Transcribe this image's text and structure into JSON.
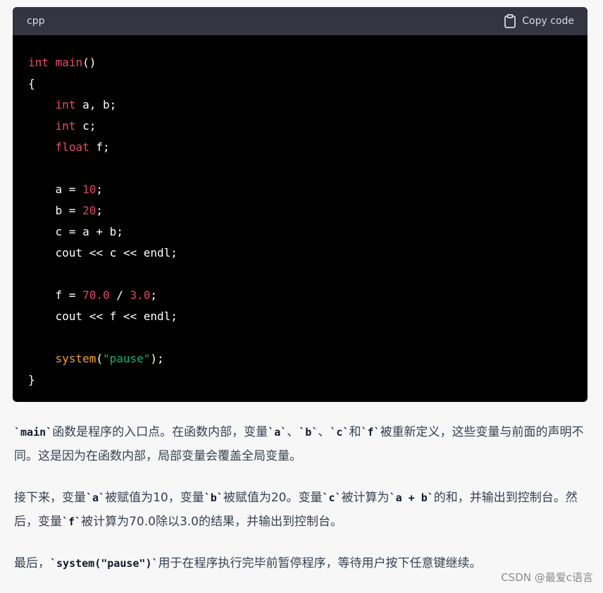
{
  "code_block": {
    "language": "cpp",
    "copy_label": "Copy code",
    "lines": [
      [
        {
          "t": "int",
          "c": "kw"
        },
        {
          "t": " "
        },
        {
          "t": "main",
          "c": "fn"
        },
        {
          "t": "()"
        }
      ],
      [
        {
          "t": "{"
        }
      ],
      [
        {
          "t": "    "
        },
        {
          "t": "int",
          "c": "kw"
        },
        {
          "t": " a, b;"
        }
      ],
      [
        {
          "t": "    "
        },
        {
          "t": "int",
          "c": "kw"
        },
        {
          "t": " c;"
        }
      ],
      [
        {
          "t": "    "
        },
        {
          "t": "float",
          "c": "kw"
        },
        {
          "t": " f;"
        }
      ],
      [
        {
          "t": ""
        }
      ],
      [
        {
          "t": "    a = "
        },
        {
          "t": "10",
          "c": "num"
        },
        {
          "t": ";"
        }
      ],
      [
        {
          "t": "    b = "
        },
        {
          "t": "20",
          "c": "num"
        },
        {
          "t": ";"
        }
      ],
      [
        {
          "t": "    c = a + b;"
        }
      ],
      [
        {
          "t": "    cout << c << endl;"
        }
      ],
      [
        {
          "t": ""
        }
      ],
      [
        {
          "t": "    f = "
        },
        {
          "t": "70.0",
          "c": "num"
        },
        {
          "t": " / "
        },
        {
          "t": "3.0",
          "c": "num"
        },
        {
          "t": ";"
        }
      ],
      [
        {
          "t": "    cout << f << endl;"
        }
      ],
      [
        {
          "t": ""
        }
      ],
      [
        {
          "t": "    "
        },
        {
          "t": "system",
          "c": "sys"
        },
        {
          "t": "("
        },
        {
          "t": "\"pause\"",
          "c": "str"
        },
        {
          "t": ");"
        }
      ],
      [
        {
          "t": "}"
        }
      ]
    ]
  },
  "answer": {
    "paragraphs": [
      [
        {
          "t": "`main`",
          "code": true
        },
        {
          "t": "函数是程序的入口点。在函数内部，变量"
        },
        {
          "t": "`a`",
          "code": true
        },
        {
          "t": "、"
        },
        {
          "t": "`b`",
          "code": true
        },
        {
          "t": "、"
        },
        {
          "t": "`c`",
          "code": true
        },
        {
          "t": "和"
        },
        {
          "t": "`f`",
          "code": true
        },
        {
          "t": "被重新定义，这些变量与前面的声明不同。这是因为在函数内部，局部变量会覆盖全局变量。"
        }
      ],
      [
        {
          "t": "接下来，变量"
        },
        {
          "t": "`a`",
          "code": true
        },
        {
          "t": "被赋值为10，变量"
        },
        {
          "t": "`b`",
          "code": true
        },
        {
          "t": "被赋值为20。变量"
        },
        {
          "t": "`c`",
          "code": true
        },
        {
          "t": "被计算为"
        },
        {
          "t": "`a + b`",
          "code": true
        },
        {
          "t": "的和，并输出到控制台。然后，变量"
        },
        {
          "t": "`f`",
          "code": true
        },
        {
          "t": "被计算为70.0除以3.0的结果，并输出到控制台。"
        }
      ],
      [
        {
          "t": "最后，"
        },
        {
          "t": "`system(\"pause\")`",
          "code": true
        },
        {
          "t": "用于在程序执行完毕前暂停程序，等待用户按下任意键继续。"
        }
      ]
    ]
  },
  "watermark": "CSDN @最爱c语言"
}
